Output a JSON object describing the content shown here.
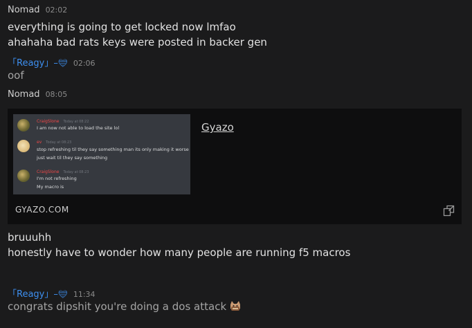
{
  "messages": [
    {
      "author": "Nomad",
      "time": "02:02",
      "lines": [
        "everything is going to get locked now lmfao",
        "ahahaha bad rats keys were posted in backer gen"
      ]
    },
    {
      "author": "「Reagy」–",
      "time": "02:06",
      "lines": [
        "oof"
      ]
    },
    {
      "author": "Nomad",
      "time": "08:05",
      "embed": {
        "title": "Gyazo",
        "domain": "GYAZO.COM",
        "icon": "open-external-icon",
        "thumbnail": {
          "messages": [
            {
              "name": "CraigSlone",
              "time": "Today at 08:22",
              "lines": [
                "I am now not able to load the site lol"
              ]
            },
            {
              "name": "ev",
              "time": "Today at 08:23",
              "lines": [
                "stop refreshing til they say something man its only making it worse",
                "just wait til they say something"
              ]
            },
            {
              "name": "CraigSlone",
              "time": "Today at 08:23",
              "lines": [
                "I'm not refreshing",
                "My macro is"
              ]
            }
          ]
        }
      },
      "lines": [
        "bruuuhh",
        "honestly have to wonder how many people are running f5 macros"
      ]
    },
    {
      "author": "「Reagy」–",
      "time": "11:34",
      "lines": [
        "congrats dipshit you're doing a dos attack"
      ],
      "emoji": "cat-emoji"
    }
  ],
  "colors": {
    "background": "#1b1b1c",
    "author_blue": "#3d8ff0",
    "embed_bg": "#0e0e0f",
    "discord_bg": "#36393f",
    "discord_name": "#f04747"
  }
}
